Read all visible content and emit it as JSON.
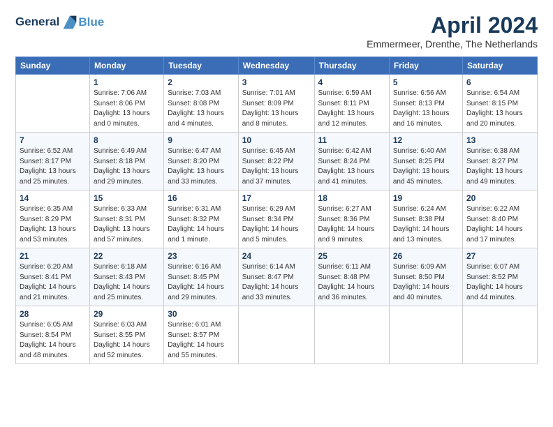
{
  "logo": {
    "line1": "General",
    "line2": "Blue"
  },
  "title": "April 2024",
  "subtitle": "Emmermeer, Drenthe, The Netherlands",
  "weekdays": [
    "Sunday",
    "Monday",
    "Tuesday",
    "Wednesday",
    "Thursday",
    "Friday",
    "Saturday"
  ],
  "weeks": [
    [
      {
        "day": "",
        "sunrise": "",
        "sunset": "",
        "daylight": ""
      },
      {
        "day": "1",
        "sunrise": "Sunrise: 7:06 AM",
        "sunset": "Sunset: 8:06 PM",
        "daylight": "Daylight: 13 hours and 0 minutes."
      },
      {
        "day": "2",
        "sunrise": "Sunrise: 7:03 AM",
        "sunset": "Sunset: 8:08 PM",
        "daylight": "Daylight: 13 hours and 4 minutes."
      },
      {
        "day": "3",
        "sunrise": "Sunrise: 7:01 AM",
        "sunset": "Sunset: 8:09 PM",
        "daylight": "Daylight: 13 hours and 8 minutes."
      },
      {
        "day": "4",
        "sunrise": "Sunrise: 6:59 AM",
        "sunset": "Sunset: 8:11 PM",
        "daylight": "Daylight: 13 hours and 12 minutes."
      },
      {
        "day": "5",
        "sunrise": "Sunrise: 6:56 AM",
        "sunset": "Sunset: 8:13 PM",
        "daylight": "Daylight: 13 hours and 16 minutes."
      },
      {
        "day": "6",
        "sunrise": "Sunrise: 6:54 AM",
        "sunset": "Sunset: 8:15 PM",
        "daylight": "Daylight: 13 hours and 20 minutes."
      }
    ],
    [
      {
        "day": "7",
        "sunrise": "Sunrise: 6:52 AM",
        "sunset": "Sunset: 8:17 PM",
        "daylight": "Daylight: 13 hours and 25 minutes."
      },
      {
        "day": "8",
        "sunrise": "Sunrise: 6:49 AM",
        "sunset": "Sunset: 8:18 PM",
        "daylight": "Daylight: 13 hours and 29 minutes."
      },
      {
        "day": "9",
        "sunrise": "Sunrise: 6:47 AM",
        "sunset": "Sunset: 8:20 PM",
        "daylight": "Daylight: 13 hours and 33 minutes."
      },
      {
        "day": "10",
        "sunrise": "Sunrise: 6:45 AM",
        "sunset": "Sunset: 8:22 PM",
        "daylight": "Daylight: 13 hours and 37 minutes."
      },
      {
        "day": "11",
        "sunrise": "Sunrise: 6:42 AM",
        "sunset": "Sunset: 8:24 PM",
        "daylight": "Daylight: 13 hours and 41 minutes."
      },
      {
        "day": "12",
        "sunrise": "Sunrise: 6:40 AM",
        "sunset": "Sunset: 8:25 PM",
        "daylight": "Daylight: 13 hours and 45 minutes."
      },
      {
        "day": "13",
        "sunrise": "Sunrise: 6:38 AM",
        "sunset": "Sunset: 8:27 PM",
        "daylight": "Daylight: 13 hours and 49 minutes."
      }
    ],
    [
      {
        "day": "14",
        "sunrise": "Sunrise: 6:35 AM",
        "sunset": "Sunset: 8:29 PM",
        "daylight": "Daylight: 13 hours and 53 minutes."
      },
      {
        "day": "15",
        "sunrise": "Sunrise: 6:33 AM",
        "sunset": "Sunset: 8:31 PM",
        "daylight": "Daylight: 13 hours and 57 minutes."
      },
      {
        "day": "16",
        "sunrise": "Sunrise: 6:31 AM",
        "sunset": "Sunset: 8:32 PM",
        "daylight": "Daylight: 14 hours and 1 minute."
      },
      {
        "day": "17",
        "sunrise": "Sunrise: 6:29 AM",
        "sunset": "Sunset: 8:34 PM",
        "daylight": "Daylight: 14 hours and 5 minutes."
      },
      {
        "day": "18",
        "sunrise": "Sunrise: 6:27 AM",
        "sunset": "Sunset: 8:36 PM",
        "daylight": "Daylight: 14 hours and 9 minutes."
      },
      {
        "day": "19",
        "sunrise": "Sunrise: 6:24 AM",
        "sunset": "Sunset: 8:38 PM",
        "daylight": "Daylight: 14 hours and 13 minutes."
      },
      {
        "day": "20",
        "sunrise": "Sunrise: 6:22 AM",
        "sunset": "Sunset: 8:40 PM",
        "daylight": "Daylight: 14 hours and 17 minutes."
      }
    ],
    [
      {
        "day": "21",
        "sunrise": "Sunrise: 6:20 AM",
        "sunset": "Sunset: 8:41 PM",
        "daylight": "Daylight: 14 hours and 21 minutes."
      },
      {
        "day": "22",
        "sunrise": "Sunrise: 6:18 AM",
        "sunset": "Sunset: 8:43 PM",
        "daylight": "Daylight: 14 hours and 25 minutes."
      },
      {
        "day": "23",
        "sunrise": "Sunrise: 6:16 AM",
        "sunset": "Sunset: 8:45 PM",
        "daylight": "Daylight: 14 hours and 29 minutes."
      },
      {
        "day": "24",
        "sunrise": "Sunrise: 6:14 AM",
        "sunset": "Sunset: 8:47 PM",
        "daylight": "Daylight: 14 hours and 33 minutes."
      },
      {
        "day": "25",
        "sunrise": "Sunrise: 6:11 AM",
        "sunset": "Sunset: 8:48 PM",
        "daylight": "Daylight: 14 hours and 36 minutes."
      },
      {
        "day": "26",
        "sunrise": "Sunrise: 6:09 AM",
        "sunset": "Sunset: 8:50 PM",
        "daylight": "Daylight: 14 hours and 40 minutes."
      },
      {
        "day": "27",
        "sunrise": "Sunrise: 6:07 AM",
        "sunset": "Sunset: 8:52 PM",
        "daylight": "Daylight: 14 hours and 44 minutes."
      }
    ],
    [
      {
        "day": "28",
        "sunrise": "Sunrise: 6:05 AM",
        "sunset": "Sunset: 8:54 PM",
        "daylight": "Daylight: 14 hours and 48 minutes."
      },
      {
        "day": "29",
        "sunrise": "Sunrise: 6:03 AM",
        "sunset": "Sunset: 8:55 PM",
        "daylight": "Daylight: 14 hours and 52 minutes."
      },
      {
        "day": "30",
        "sunrise": "Sunrise: 6:01 AM",
        "sunset": "Sunset: 8:57 PM",
        "daylight": "Daylight: 14 hours and 55 minutes."
      },
      {
        "day": "",
        "sunrise": "",
        "sunset": "",
        "daylight": ""
      },
      {
        "day": "",
        "sunrise": "",
        "sunset": "",
        "daylight": ""
      },
      {
        "day": "",
        "sunrise": "",
        "sunset": "",
        "daylight": ""
      },
      {
        "day": "",
        "sunrise": "",
        "sunset": "",
        "daylight": ""
      }
    ]
  ]
}
